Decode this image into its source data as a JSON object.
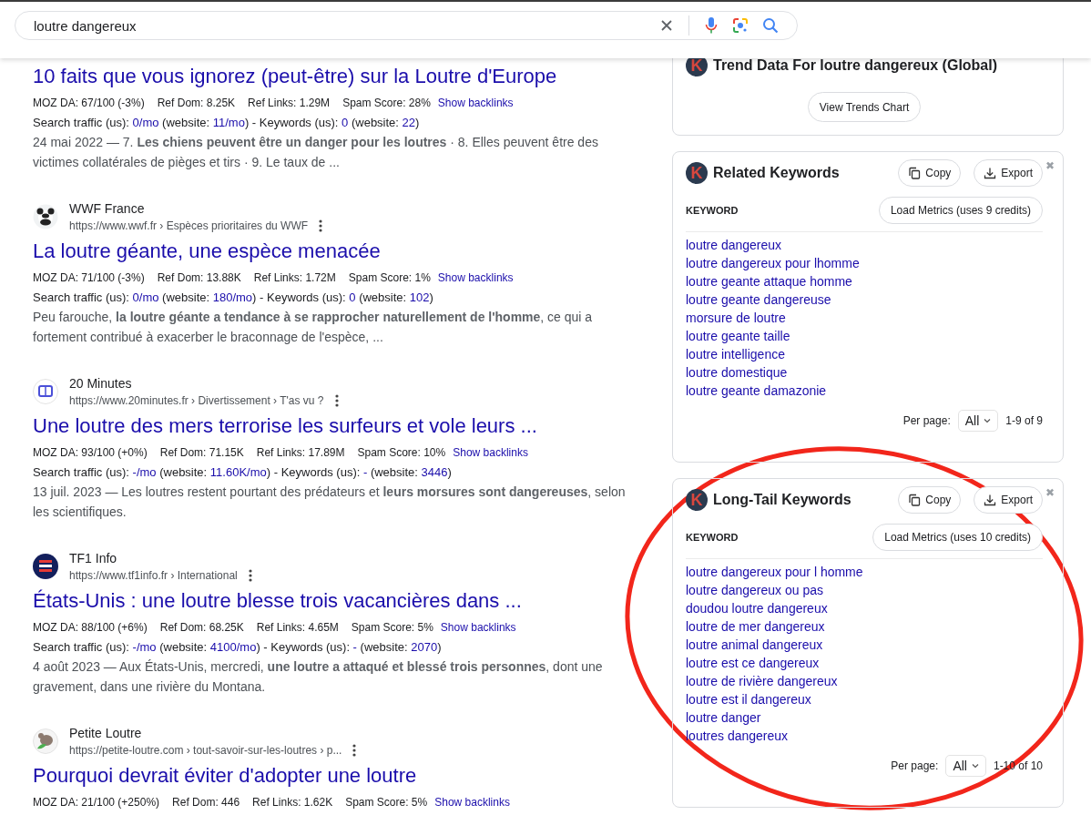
{
  "search": {
    "value": "loutre dangereux"
  },
  "results": [
    {
      "title": "10 faits que vous ignorez (peut-être) sur la Loutre d'Europe",
      "metrics": [
        "MOZ DA: 67/100 (-3%)",
        "Ref Dom: 8.25K",
        "Ref Links: 1.29M",
        "Spam Score: 28%"
      ],
      "backlinks": "Show backlinks",
      "traffic": [
        {
          "text": "Search traffic (us): ",
          "kind": "plain"
        },
        {
          "text": "0/mo",
          "kind": "link"
        },
        {
          "text": " (website: ",
          "kind": "plain"
        },
        {
          "text": "11/mo",
          "kind": "link"
        },
        {
          "text": ") - Keywords (us): ",
          "kind": "plain"
        },
        {
          "text": "0",
          "kind": "link"
        },
        {
          "text": " (website: ",
          "kind": "plain"
        },
        {
          "text": "22",
          "kind": "link"
        },
        {
          "text": ")",
          "kind": "plain"
        }
      ],
      "snippet": "24 mai 2022 — 7. **Les chiens peuvent être un danger pour les loutres** · 8. Elles peuvent être des victimes collatérales de pièges et tirs · 9. Le taux de ..."
    },
    {
      "site": {
        "name": "WWF France",
        "url": "https://www.wwf.fr › Espèces prioritaires du WWF",
        "kind": "panda"
      },
      "title": "La loutre géante, une espèce menacée",
      "metrics": [
        "MOZ DA: 71/100 (-3%)",
        "Ref Dom: 13.88K",
        "Ref Links: 1.72M",
        "Spam Score: 1%"
      ],
      "backlinks": "Show backlinks",
      "traffic": [
        {
          "text": "Search traffic (us): ",
          "kind": "plain"
        },
        {
          "text": "0/mo",
          "kind": "link"
        },
        {
          "text": " (website: ",
          "kind": "plain"
        },
        {
          "text": "180/mo",
          "kind": "link"
        },
        {
          "text": ") - Keywords (us): ",
          "kind": "plain"
        },
        {
          "text": "0",
          "kind": "link"
        },
        {
          "text": " (website: ",
          "kind": "plain"
        },
        {
          "text": "102",
          "kind": "link"
        },
        {
          "text": ")",
          "kind": "plain"
        }
      ],
      "snippet": "Peu farouche, **la loutre géante a tendance à se rapprocher naturellement de l'homme**, ce qui a fortement contribué à exacerber le braconnage de l'espèce, ..."
    },
    {
      "site": {
        "name": "20 Minutes",
        "url": "https://www.20minutes.fr › Divertissement › T'as vu ?",
        "kind": "ring"
      },
      "title": "Une loutre des mers terrorise les surfeurs et vole leurs ...",
      "metrics": [
        "MOZ DA: 93/100 (+0%)",
        "Ref Dom: 71.15K",
        "Ref Links: 17.89M",
        "Spam Score: 10%"
      ],
      "backlinks": "Show backlinks",
      "traffic": [
        {
          "text": "Search traffic (us): ",
          "kind": "plain"
        },
        {
          "text": "-/mo",
          "kind": "link"
        },
        {
          "text": " (website: ",
          "kind": "plain"
        },
        {
          "text": "11.60K/mo",
          "kind": "link"
        },
        {
          "text": ") - Keywords (us): ",
          "kind": "plain"
        },
        {
          "text": "-",
          "kind": "link"
        },
        {
          "text": " (website: ",
          "kind": "plain"
        },
        {
          "text": "3446",
          "kind": "link"
        },
        {
          "text": ")",
          "kind": "plain"
        }
      ],
      "snippet": "13 juil. 2023 — Les loutres restent pourtant des prédateurs et **leurs morsures sont dangereuses**, selon les scientifiques."
    },
    {
      "site": {
        "name": "TF1 Info",
        "url": "https://www.tf1info.fr › International",
        "kind": "badge"
      },
      "title": "États-Unis : une loutre blesse trois vacancières dans ...",
      "metrics": [
        "MOZ DA: 88/100 (+6%)",
        "Ref Dom: 68.25K",
        "Ref Links: 4.65M",
        "Spam Score: 5%"
      ],
      "backlinks": "Show backlinks",
      "traffic": [
        {
          "text": "Search traffic (us): ",
          "kind": "plain"
        },
        {
          "text": "-/mo",
          "kind": "link"
        },
        {
          "text": " (website: ",
          "kind": "plain"
        },
        {
          "text": "4100/mo",
          "kind": "link"
        },
        {
          "text": ") - Keywords (us): ",
          "kind": "plain"
        },
        {
          "text": "-",
          "kind": "link"
        },
        {
          "text": " (website: ",
          "kind": "plain"
        },
        {
          "text": "2070",
          "kind": "link"
        },
        {
          "text": ")",
          "kind": "plain"
        }
      ],
      "snippet": "4 août 2023 — Aux États-Unis, mercredi, **une loutre a attaqué et blessé trois personnes**, dont une gravement, dans une rivière du Montana."
    },
    {
      "site": {
        "name": "Petite Loutre",
        "url": "https://petite-loutre.com › tout-savoir-sur-les-loutres › p...",
        "kind": "animal"
      },
      "title": "Pourquoi devrait éviter d'adopter une loutre",
      "metrics": [
        "MOZ DA: 21/100 (+250%)",
        "Ref Dom: 446",
        "Ref Links: 1.62K",
        "Spam Score: 5%"
      ],
      "backlinks": "Show backlinks"
    }
  ],
  "panels": [
    {
      "kind": "trend",
      "logo_letter": "K",
      "title": "Trend Data For loutre dangereux (Global)",
      "button": "View Trends Chart"
    },
    {
      "kind": "keywords",
      "logo_letter": "K",
      "title": "Related Keywords",
      "copy": "Copy",
      "export": "Export",
      "close": "✖",
      "column": "KEYWORD",
      "load": "Load Metrics (uses 9 credits)",
      "keywords": [
        "loutre dangereux",
        "loutre dangereux pour lhomme",
        "loutre geante attaque homme",
        "loutre geante dangereuse",
        "morsure de loutre",
        "loutre geante taille",
        "loutre intelligence",
        "loutre domestique",
        "loutre geante damazonie"
      ],
      "per_page_label": "Per page:",
      "per_page": "All",
      "range": "1-9 of 9"
    },
    {
      "kind": "keywords",
      "logo_letter": "K",
      "title": "Long-Tail Keywords",
      "copy": "Copy",
      "export": "Export",
      "close": "✖",
      "column": "KEYWORD",
      "load": "Load Metrics (uses 10 credits)",
      "keywords": [
        "loutre dangereux pour l homme",
        "loutre dangereux ou pas",
        "doudou loutre dangereux",
        "loutre de mer dangereux",
        "loutre animal dangereux",
        "loutre est ce dangereux",
        "loutre de rivière dangereux",
        "loutre est il dangereux",
        "loutre danger",
        "loutres dangereux"
      ],
      "per_page_label": "Per page:",
      "per_page": "All",
      "range": "1-10 of 10"
    }
  ]
}
